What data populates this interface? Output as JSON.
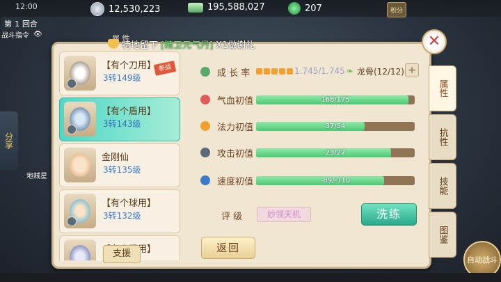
{
  "status_bar": {
    "time": "12:00"
  },
  "currency": {
    "silver": "12,530,223",
    "cash": "195,588,027",
    "jade": "207",
    "feast_label": "积分"
  },
  "battle": {
    "round_prefix": "第",
    "round_number": "1",
    "round_suffix": "回合",
    "command_label": "战斗指令"
  },
  "banner": {
    "prefix": "特地留下",
    "item": "[精卫元气丹]",
    "suffix": "X1做谢礼"
  },
  "panel": {
    "header_label": "属  性"
  },
  "pets": [
    {
      "name": "【有个刀用】",
      "level": "3转149级",
      "tag": "参战"
    },
    {
      "name": "【有个盾用】",
      "level": "3转143级"
    },
    {
      "name": "金刚仙",
      "level": "3转135级"
    },
    {
      "name": "【有个球用】",
      "level": "3转132级"
    },
    {
      "name": "【有个棍用】",
      "level": ""
    }
  ],
  "support_button": "支援",
  "stats": {
    "growth_label": "成 长 率",
    "growth_value": "1.745/1.745",
    "bone_label": "龙骨(12/12)",
    "plus_label": "+",
    "rows": [
      {
        "label": "气血初值",
        "text": "168/175",
        "value": 168,
        "max": 175,
        "color": "#e05a5a"
      },
      {
        "label": "法力初值",
        "text": "37/54",
        "value": 37,
        "max": 54,
        "color": "#f0a030"
      },
      {
        "label": "攻击初值",
        "text": "23/27",
        "value": 23,
        "max": 27,
        "color": "#5a6a78"
      },
      {
        "label": "速度初值",
        "text": "-89/-110",
        "value": 89,
        "max": 110,
        "color": "#3a7ac8"
      }
    ]
  },
  "rating": {
    "label": "评  级",
    "value": "妙领天机"
  },
  "buttons": {
    "wash": "洗练",
    "back": "返回"
  },
  "tabs": [
    "属性",
    "抗性",
    "技能",
    "图鉴"
  ],
  "side": {
    "share": "分享",
    "ally_name": "地贼星"
  },
  "auto_battle": "自动战斗"
}
